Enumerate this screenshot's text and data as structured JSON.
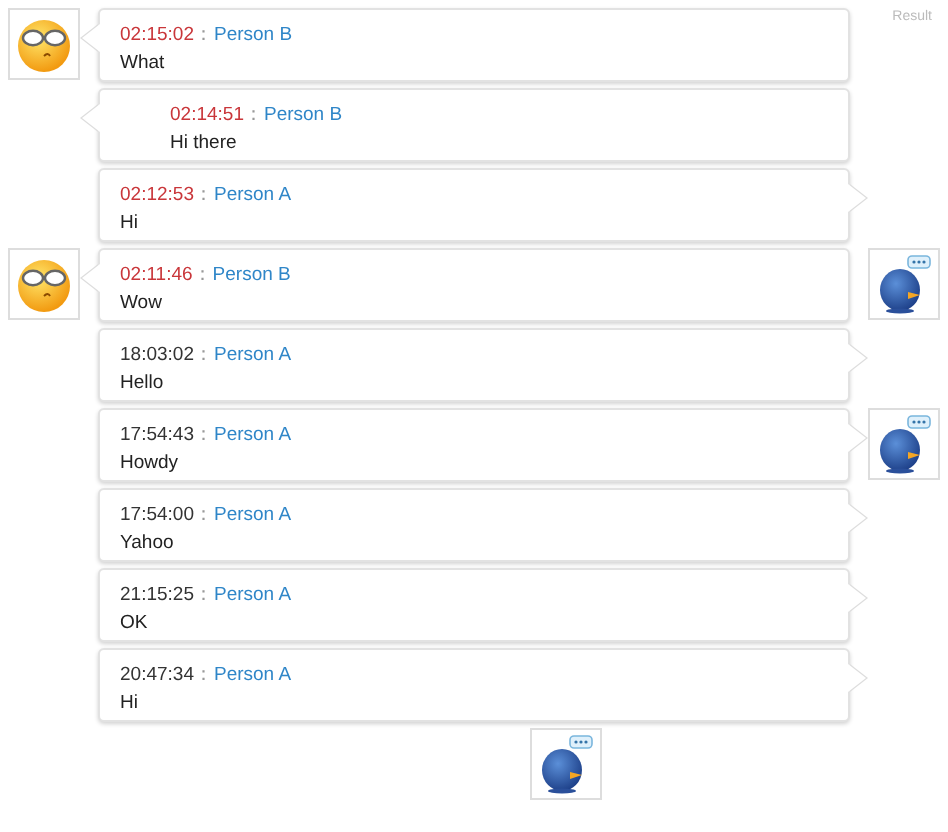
{
  "corner_label": "Result",
  "separator": "：",
  "messages": [
    {
      "time": "02:15:02",
      "sender": "Person B",
      "text": "What",
      "unread": true,
      "tail_on_left": true,
      "indented": false,
      "smiley_left": true,
      "bird_right": false
    },
    {
      "time": "02:14:51",
      "sender": "Person B",
      "text": "Hi there",
      "unread": true,
      "tail_on_left": true,
      "indented": true,
      "smiley_left": false,
      "bird_right": false
    },
    {
      "time": "02:12:53",
      "sender": "Person A",
      "text": "Hi",
      "unread": true,
      "tail_on_left": false,
      "indented": false,
      "smiley_left": false,
      "bird_right": false
    },
    {
      "time": "02:11:46",
      "sender": "Person B",
      "text": "Wow",
      "unread": true,
      "tail_on_left": true,
      "indented": false,
      "smiley_left": true,
      "bird_right": true
    },
    {
      "time": "18:03:02",
      "sender": "Person A",
      "text": "Hello",
      "unread": false,
      "tail_on_left": false,
      "indented": false,
      "smiley_left": false,
      "bird_right": false
    },
    {
      "time": "17:54:43",
      "sender": "Person A",
      "text": "Howdy",
      "unread": false,
      "tail_on_left": false,
      "indented": false,
      "smiley_left": false,
      "bird_right": true
    },
    {
      "time": "17:54:00",
      "sender": "Person A",
      "text": "Yahoo",
      "unread": false,
      "tail_on_left": false,
      "indented": false,
      "smiley_left": false,
      "bird_right": false
    },
    {
      "time": "21:15:25",
      "sender": "Person A",
      "text": "OK",
      "unread": false,
      "tail_on_left": false,
      "indented": false,
      "smiley_left": false,
      "bird_right": false
    },
    {
      "time": "20:47:34",
      "sender": "Person A",
      "text": "Hi",
      "unread": false,
      "tail_on_left": false,
      "indented": false,
      "smiley_left": false,
      "bird_right": false
    }
  ],
  "footer_bird": true
}
